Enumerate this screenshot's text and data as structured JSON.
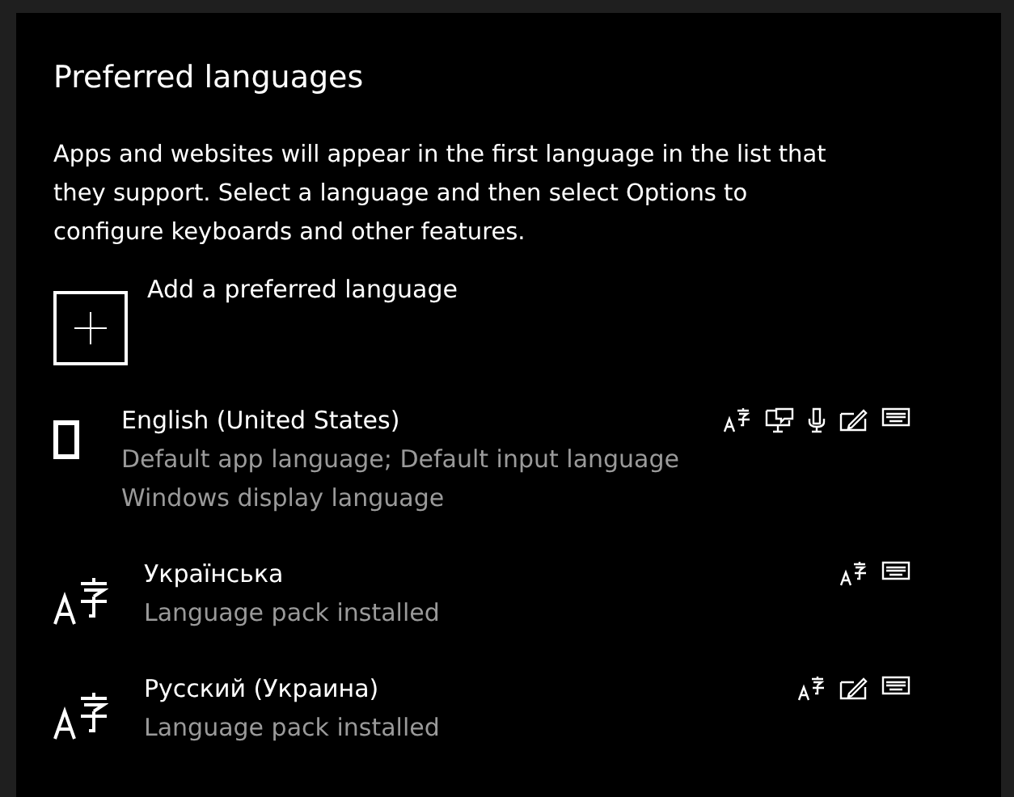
{
  "title": "Preferred languages",
  "description": "Apps and websites will appear in the first language in the list that they support. Select a language and then select Options to configure keyboards and other features.",
  "add_button": {
    "label": "Add a preferred language"
  },
  "languages": [
    {
      "name": "English (United States)",
      "kind": "display",
      "details": [
        "Default app language; Default input language",
        "Windows display language"
      ],
      "features": {
        "language_pack": true,
        "speech": true,
        "voice": true,
        "handwriting": true,
        "keyboard": true
      }
    },
    {
      "name": "Українська",
      "kind": "pack",
      "details": [
        "Language pack installed"
      ],
      "features": {
        "language_pack": true,
        "speech": false,
        "voice": false,
        "handwriting": false,
        "keyboard": true
      }
    },
    {
      "name": "Русский (Украина)",
      "kind": "pack",
      "details": [
        "Language pack installed"
      ],
      "features": {
        "language_pack": true,
        "speech": false,
        "voice": false,
        "handwriting": true,
        "keyboard": true
      }
    }
  ]
}
